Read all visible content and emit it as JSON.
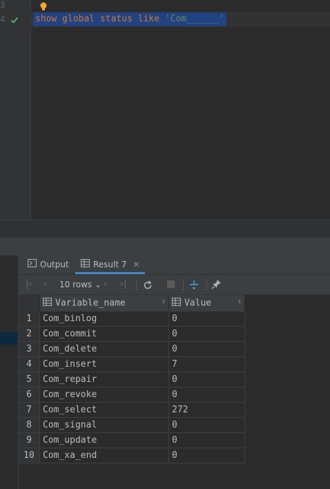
{
  "editor": {
    "line_numbers": [
      "3",
      "4"
    ],
    "sql": {
      "kw1": "show",
      "kw2": "global",
      "kw3": "status",
      "kw4": "like",
      "str": "'Com______'"
    }
  },
  "tabs": [
    {
      "label": "Output"
    },
    {
      "label": "Result 7"
    }
  ],
  "toolbar": {
    "rows_label": "10 rows"
  },
  "grid": {
    "columns": [
      "Variable_name",
      "Value"
    ],
    "rows": [
      {
        "n": "1",
        "name": "Com_binlog",
        "value": "0"
      },
      {
        "n": "2",
        "name": "Com_commit",
        "value": "0"
      },
      {
        "n": "3",
        "name": "Com_delete",
        "value": "0"
      },
      {
        "n": "4",
        "name": "Com_insert",
        "value": "7"
      },
      {
        "n": "5",
        "name": "Com_repair",
        "value": "0"
      },
      {
        "n": "6",
        "name": "Com_revoke",
        "value": "0"
      },
      {
        "n": "7",
        "name": "Com_select",
        "value": "272"
      },
      {
        "n": "8",
        "name": "Com_signal",
        "value": "0"
      },
      {
        "n": "9",
        "name": "Com_update",
        "value": "0"
      },
      {
        "n": "10",
        "name": "Com_xa_end",
        "value": "0"
      }
    ]
  },
  "colors": {
    "accent": "#4a88c7",
    "selection": "#214283",
    "keyword": "#cc7832",
    "string": "#6a8759"
  }
}
